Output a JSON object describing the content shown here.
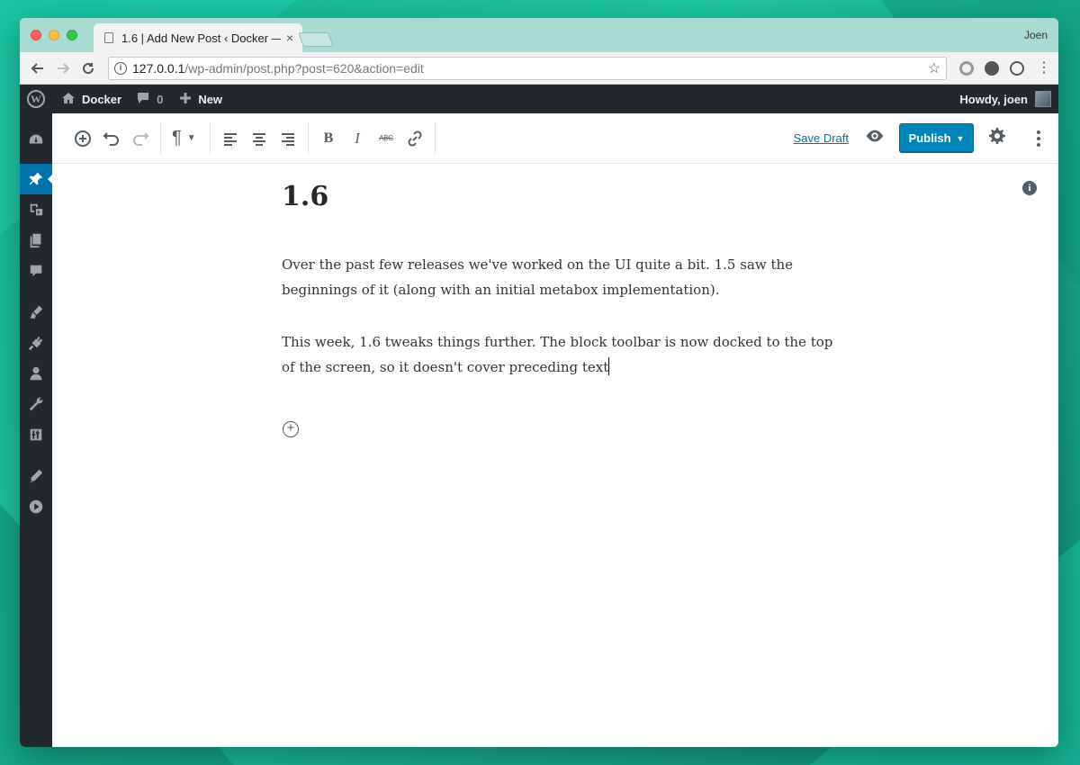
{
  "browser": {
    "tab_title": "1.6 | Add New Post ‹ Docker —",
    "tab_close": "×",
    "profile_name": "Joen",
    "url_host": "127.0.0.1",
    "url_path": "/wp-admin/post.php?post=620&action=edit"
  },
  "adminbar": {
    "site_name": "Docker",
    "comments_count": "0",
    "new_label": "New",
    "howdy": "Howdy, joen"
  },
  "sidebar": {
    "items": [
      {
        "name": "dashboard-icon"
      },
      {
        "name": "posts-icon",
        "active": true
      },
      {
        "name": "media-icon"
      },
      {
        "name": "pages-icon"
      },
      {
        "name": "comments-icon"
      },
      {
        "name": "appearance-icon"
      },
      {
        "name": "plugins-icon"
      },
      {
        "name": "users-icon"
      },
      {
        "name": "tools-icon"
      },
      {
        "name": "settings-icon"
      },
      {
        "name": "edit-icon"
      },
      {
        "name": "play-icon"
      }
    ]
  },
  "editor": {
    "paragraph_symbol": "¶",
    "bold": "B",
    "italic": "I",
    "strikethrough": "ABC",
    "save_draft": "Save Draft",
    "publish": "Publish",
    "info": "i"
  },
  "post": {
    "title": "1.6",
    "paragraphs": [
      "Over the past few releases we've worked on the UI quite a bit. 1.5 saw the beginnings of it (along with an initial metabox implementation).",
      "This week, 1.6 tweaks things further. The block toolbar is now docked to the top of the screen, so it doesn't cover preceding text"
    ]
  },
  "colors": {
    "accent": "#0073aa",
    "publish": "#0085ba",
    "admin_bar": "#23282d"
  }
}
